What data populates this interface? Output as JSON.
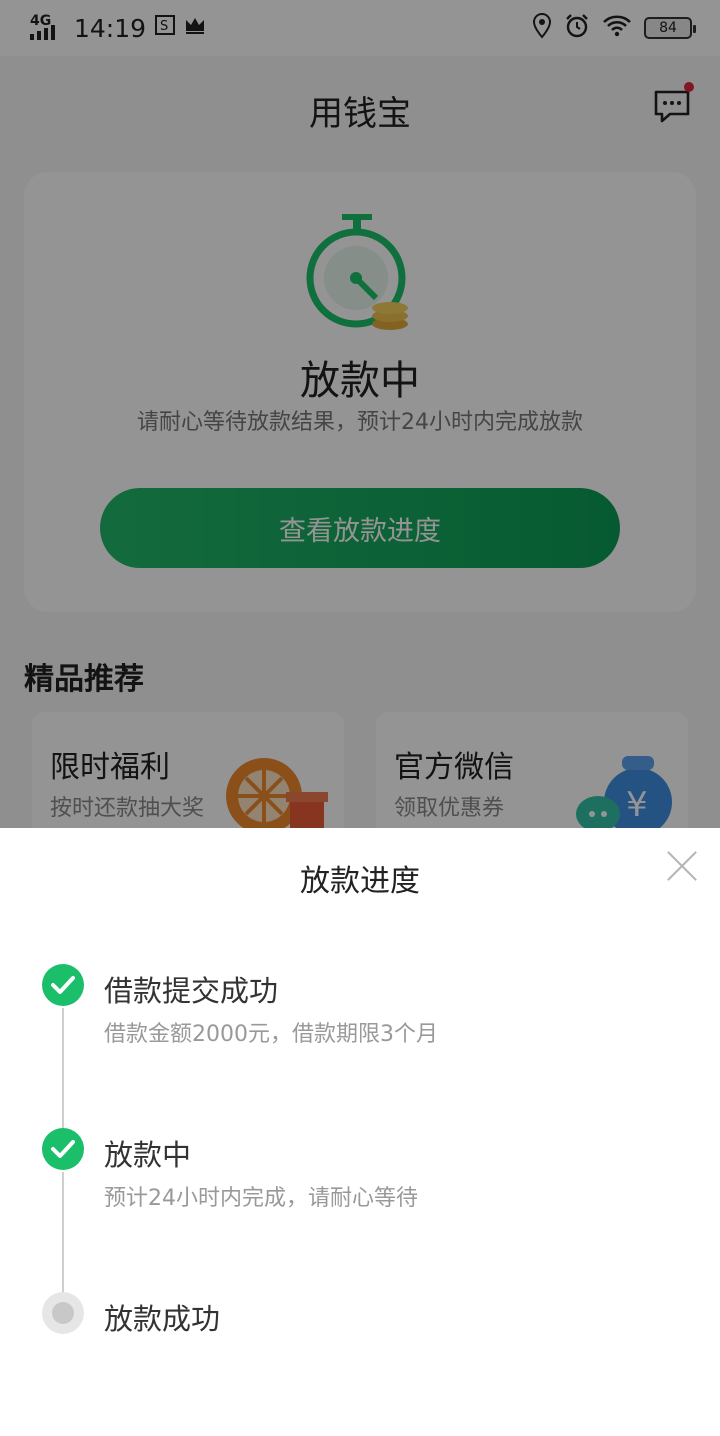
{
  "status_bar": {
    "network": "4G",
    "time": "14:19",
    "battery": "84"
  },
  "header": {
    "title": "用钱宝"
  },
  "loan_status": {
    "title": "放款中",
    "subtitle": "请耐心等待放款结果，预计24小时内完成放款",
    "button_label": "查看放款进度"
  },
  "recommend": {
    "title": "精品推荐",
    "items": [
      {
        "title": "限时福利",
        "subtitle": "按时还款抽大奖"
      },
      {
        "title": "官方微信",
        "subtitle": "领取优惠券"
      }
    ]
  },
  "sheet": {
    "title": "放款进度",
    "steps": [
      {
        "title": "借款提交成功",
        "desc": "借款金额2000元，借款期限3个月",
        "status": "done"
      },
      {
        "title": "放款中",
        "desc": "预计24小时内完成，请耐心等待",
        "status": "done"
      },
      {
        "title": "放款成功",
        "desc": "",
        "status": "pending"
      }
    ]
  },
  "colors": {
    "accent": "#1bbf6a",
    "button_gradient_start": "#22b869",
    "button_gradient_end": "#0c9c55",
    "notification_dot": "#e0263a"
  },
  "icons": [
    "signal-icon",
    "sim-icon",
    "crown-icon",
    "location-icon",
    "alarm-icon",
    "wifi-icon",
    "battery-icon",
    "message-icon",
    "stopwatch-icon",
    "close-icon",
    "check-icon"
  ]
}
